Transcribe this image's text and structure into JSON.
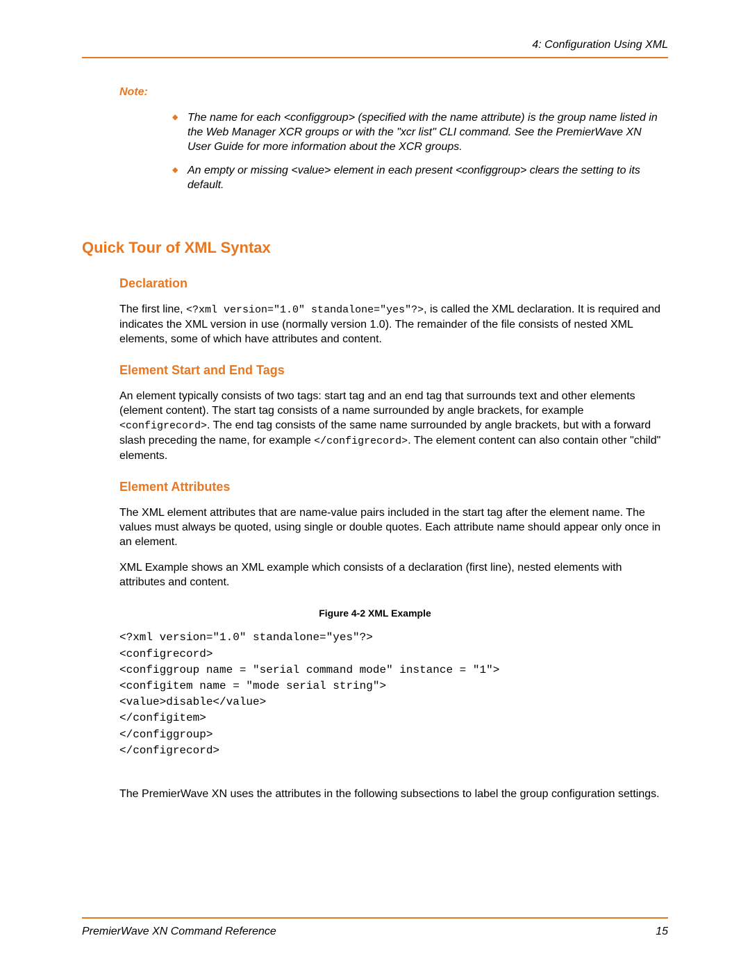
{
  "header": {
    "chapter": "4: Configuration Using XML"
  },
  "note": {
    "label": "Note:",
    "items": [
      "The name for each <configgroup> (specified with the name attribute) is the group name listed in the Web Manager XCR groups or with the \"xcr list\" CLI command. See the PremierWave XN User Guide for more information about the XCR groups.",
      "An empty or missing <value> element in each present <configgroup> clears the setting to its default."
    ]
  },
  "section": {
    "title": "Quick Tour of XML Syntax"
  },
  "declaration": {
    "title": "Declaration",
    "text_pre": "The first line, ",
    "code": "<?xml version=\"1.0\" standalone=\"yes\"?>",
    "text_post": ", is called the XML declaration.  It is required and indicates the XML version in use (normally version 1.0).  The remainder of the file consists of nested XML elements, some of which have attributes and content."
  },
  "tags": {
    "title": "Element Start and End Tags",
    "text_pre": "An element typically consists of two tags: start tag and an end tag that surrounds text and other elements (element content).  The start tag consists of a name surrounded by angle brackets, for example ",
    "code1": "<configrecord>",
    "text_mid": ".  The end tag consists of the same name surrounded by angle brackets, but with a forward slash preceding the name, for example ",
    "code2": "</configrecord>",
    "text_post": ".  The element content can also contain other \"child\" elements."
  },
  "attributes": {
    "title": "Element Attributes",
    "para1": "The XML element attributes that are name-value pairs included in the start tag after the element name.  The values must always be quoted, using single or double quotes.  Each attribute name should appear only once in an element.",
    "para2": "XML Example shows an XML example which consists of a declaration (first line), nested elements with attributes and content."
  },
  "figure": {
    "caption": "Figure 4-2  XML Example",
    "code": "<?xml version=\"1.0\" standalone=\"yes\"?>\n<configrecord>\n<configgroup name = \"serial command mode\" instance = \"1\">\n<configitem name = \"mode serial string\">\n<value>disable</value>\n</configitem>\n</configgroup>\n</configrecord>"
  },
  "closing": {
    "text": "The PremierWave XN uses the attributes in the following subsections to label the group configuration settings."
  },
  "footer": {
    "doc_title": "PremierWave XN Command Reference",
    "page_number": "15"
  }
}
